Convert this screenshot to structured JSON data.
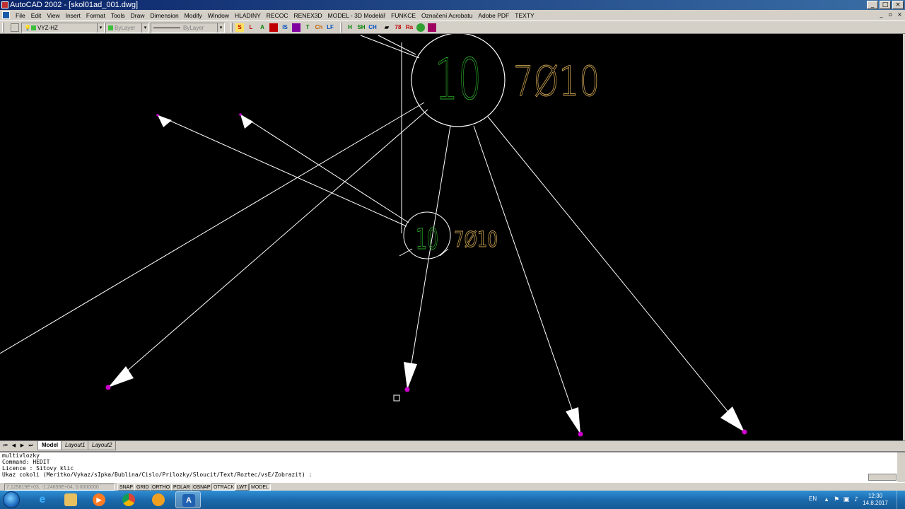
{
  "window": {
    "title": "AutoCAD 2002 - [skol01ad_001.dwg]",
    "min_glyph": "_",
    "max_glyph": "□",
    "close_glyph": "×"
  },
  "menu": {
    "items": [
      "File",
      "Edit",
      "View",
      "Insert",
      "Format",
      "Tools",
      "Draw",
      "Dimension",
      "Modify",
      "Window",
      "HLADINY",
      "RECOC",
      "RENEX3D",
      "MODEL - 3D Modelář",
      "FUNKCE",
      "Označení Acrobatu",
      "Adobe PDF",
      "TEXTY"
    ],
    "mdi_min": "_",
    "mdi_restore": "▫",
    "mdi_close": "×"
  },
  "toolbar": {
    "layer_value": "VYZ-HZ",
    "color_value": "ByLayer",
    "linetype_value": "ByLayer",
    "combo_arrow": "▾"
  },
  "drawing": {
    "big_bubble_number": "10",
    "big_bubble_label": "7Ø10",
    "small_bubble_number": "10",
    "small_bubble_label": "7Ø10",
    "colors": {
      "background": "#000000",
      "lines": "#ffffff",
      "number_text": "#2aa52a",
      "label_text": "#c8a050",
      "grip": "#cc00cc"
    }
  },
  "layout_tabs": {
    "nav": [
      "⏮",
      "◀",
      "▶",
      "⏭"
    ],
    "tabs": [
      "Model",
      "Layout1",
      "Layout2"
    ]
  },
  "command_line": {
    "lines": [
      "multivlozky",
      "Command:  HEDIT",
      "Licence : Sitovy klic",
      "Ukaz cokoli (Meritko/Vykaz/sIpka/Bublina/Cislo/Prilozky/Sloucit/Text/Roztec/vsE/Zobrazit) :"
    ]
  },
  "status_bar": {
    "coordinates": "7.125819E+03, -1.24656E+04, 0.0000000",
    "toggles": [
      "SNAP",
      "GRID",
      "ORTHO",
      "POLAR",
      "OSNAP",
      "OTRACK",
      "LWT",
      "MODEL"
    ]
  },
  "taskbar": {
    "language": "EN",
    "time": "12:30",
    "date": "14.8.2017",
    "apps": [
      "windows-start",
      "internet-explorer",
      "file-explorer",
      "media-player",
      "chrome",
      "app-orange",
      "autocad"
    ]
  }
}
